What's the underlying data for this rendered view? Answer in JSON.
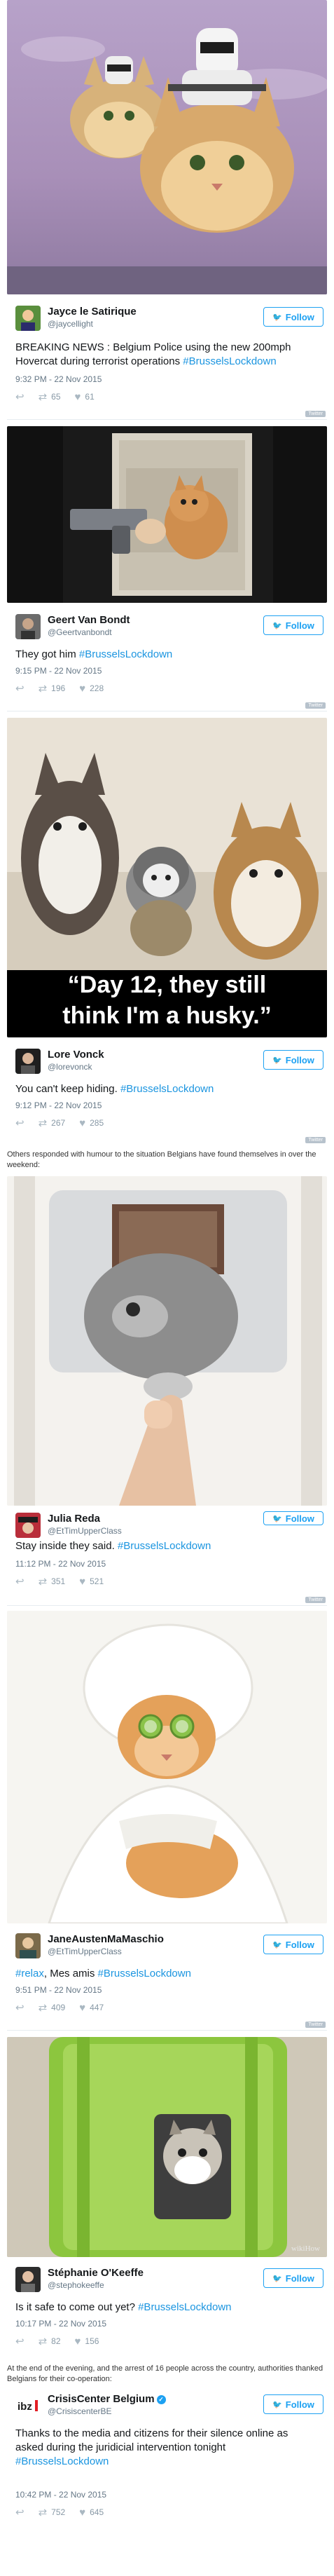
{
  "colors": {
    "link": "#1b95e0",
    "follow": "#1da1f2",
    "muted": "#657786"
  },
  "follow_label": "Follow",
  "twitter_badge": "Twitter",
  "tweets": [
    {
      "name": "Jayce le Satirique",
      "handle": "@jaycellight",
      "text": "BREAKING NEWS : Belgium Police using the new 200mph Hovercat during terrorist operations ",
      "hashtag": "#BrusselsLockdown",
      "time": "9:32 PM - 22 Nov 2015",
      "retweets": "65",
      "likes": "61"
    },
    {
      "name": "Geert Van Bondt",
      "handle": "@Geertvanbondt",
      "text": "They got him ",
      "hashtag": "#BrusselsLockdown",
      "time": "9:15 PM - 22 Nov 2015",
      "retweets": "196",
      "likes": "228"
    },
    {
      "name": "Lore Vonck",
      "handle": "@lorevonck",
      "text": "You can't keep hiding. ",
      "hashtag": "#BrusselsLockdown",
      "time": "9:12 PM - 22 Nov 2015",
      "retweets": "267",
      "likes": "285"
    },
    {
      "name": "Julia Reda",
      "handle": "@EtTimUpperClass",
      "text": "Stay inside they said. ",
      "hashtag": "#BrusselsLockdown",
      "time": "11:12 PM - 22 Nov 2015",
      "retweets": "351",
      "likes": "521"
    },
    {
      "name": "JaneAustenMaMaschio",
      "handle": "@EtTimUpperClass",
      "hashtag_lead": "#relax",
      "text": ", Mes amis ",
      "hashtag": "#BrusselsLockdown",
      "time": "9:51 PM - 22 Nov 2015",
      "retweets": "409",
      "likes": "447"
    },
    {
      "name": "Stéphanie O'Keeffe",
      "handle": "@stephokeeffe",
      "text": "Is it safe to come out yet? ",
      "hashtag": "#BrusselsLockdown",
      "time": "10:17 PM - 22 Nov 2015",
      "retweets": "82",
      "likes": "156"
    },
    {
      "name": "CrisisCenter Belgium",
      "handle": "@CrisiscenterBE",
      "avatar_text": "ibz",
      "text": "Thanks to the media and citizens for their silence online as asked during the juridicial intervention tonight ",
      "hashtag": "#BrusselsLockdown",
      "time": "10:42 PM - 22 Nov 2015",
      "retweets": "752",
      "likes": "645"
    }
  ],
  "meme_caption_line1": "“Day 12, they still",
  "meme_caption_line2": "think I'm a husky.”",
  "captions": {
    "humour": "Others responded with humour to the situation Belgians have found themselves in over the weekend:",
    "end": "At the end of the evening, and the arrest of 16 people across the country, authorities thanked Belgians for their co-operation:"
  },
  "watermark": "wikiHow"
}
